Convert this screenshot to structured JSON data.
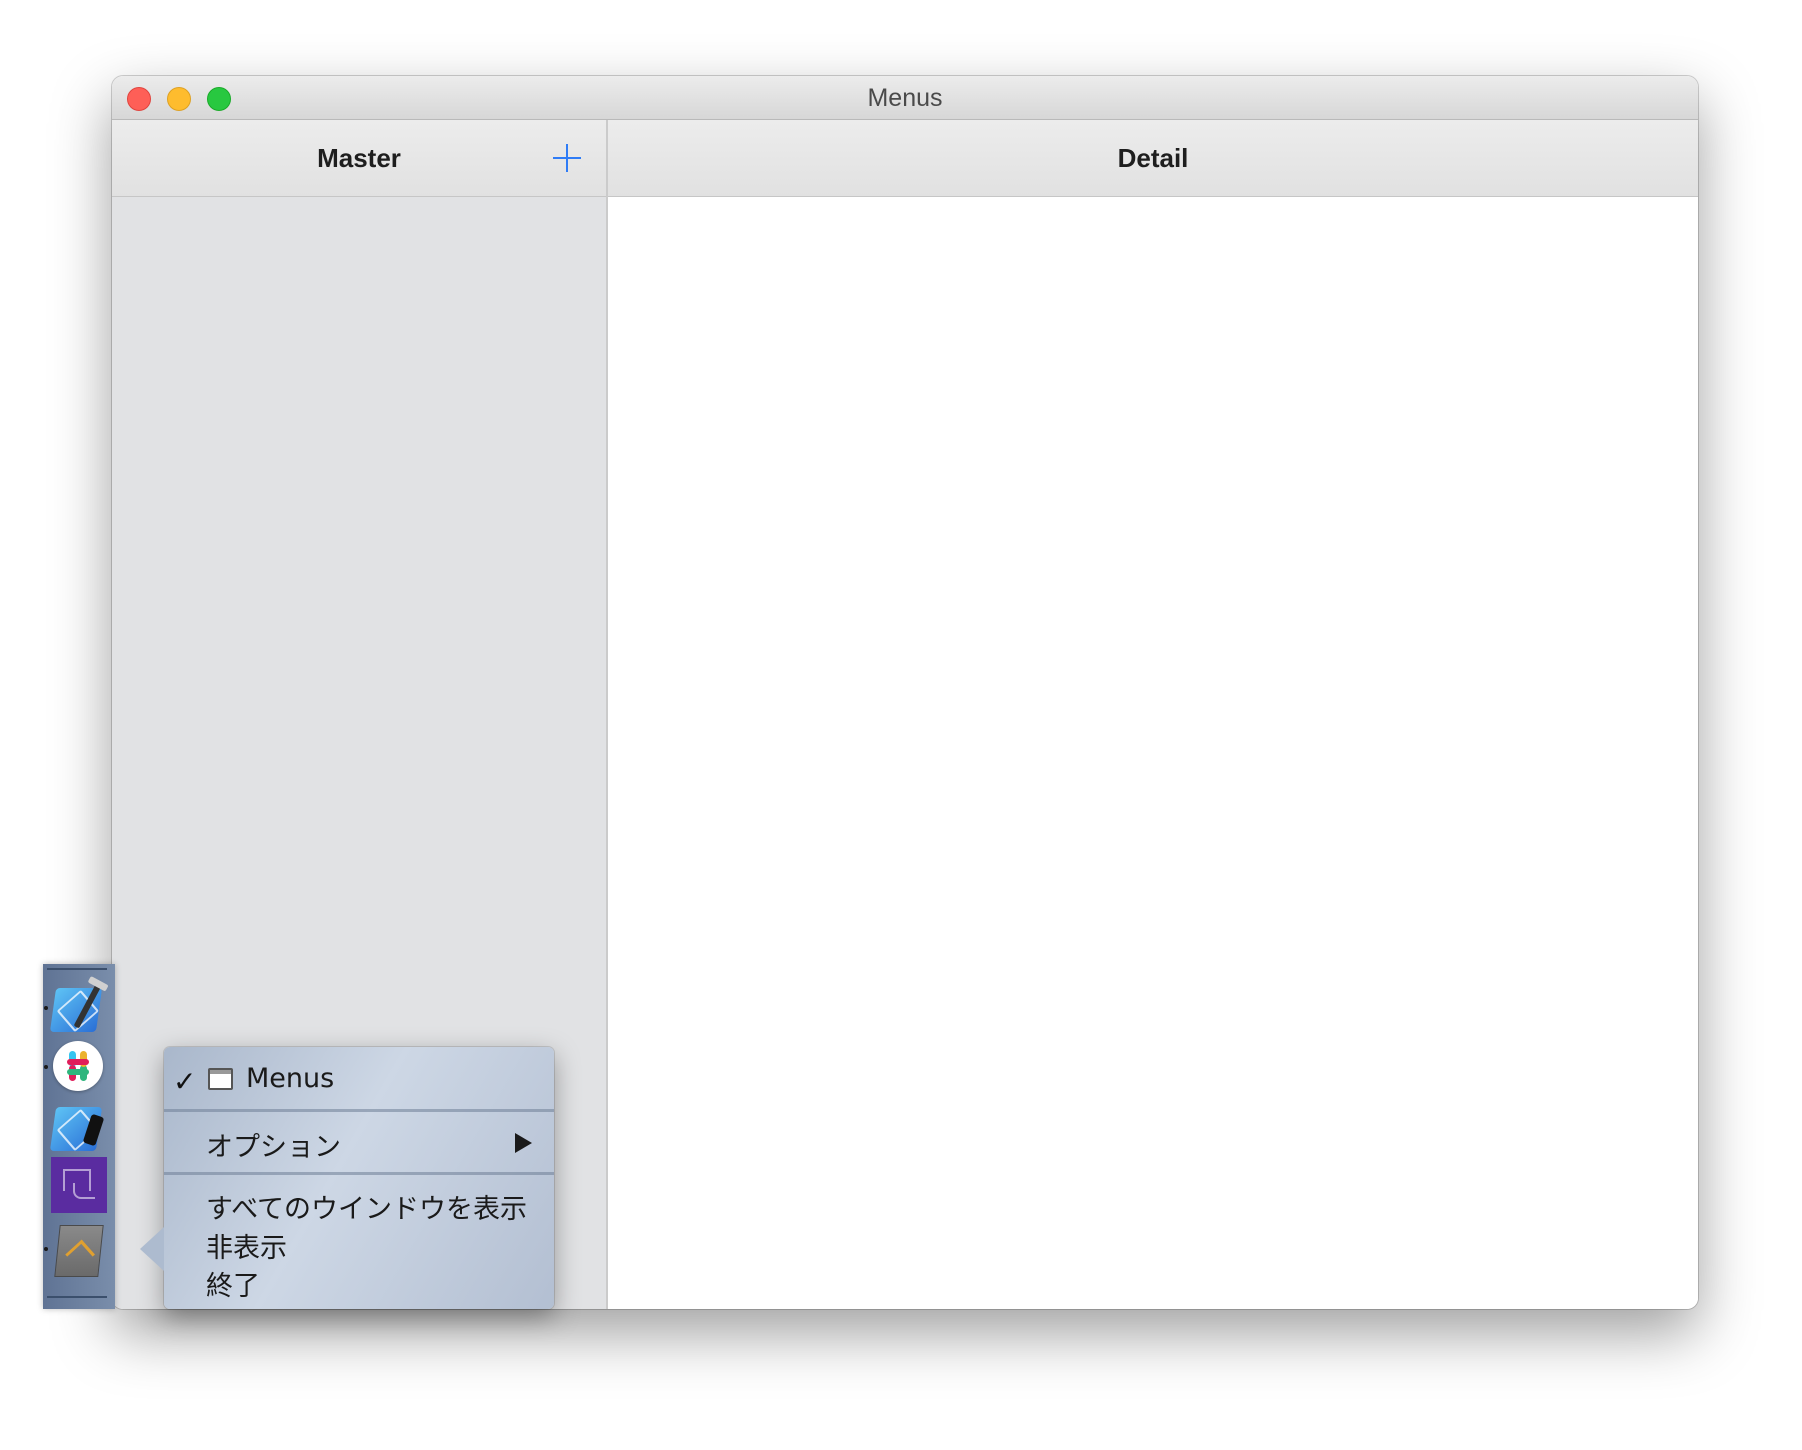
{
  "window": {
    "title": "Menus"
  },
  "master": {
    "title": "Master",
    "add_icon": "plus-icon"
  },
  "detail": {
    "title": "Detail"
  },
  "dock": {
    "items": [
      {
        "icon": "xcode-icon",
        "running": true
      },
      {
        "icon": "slack-icon",
        "running": true
      },
      {
        "icon": "simulator-icon",
        "running": false
      },
      {
        "icon": "purple-app-icon",
        "running": false
      },
      {
        "icon": "menus-app-icon",
        "running": true
      }
    ]
  },
  "context_menu": {
    "window_item": {
      "label": "Menus",
      "checked": true,
      "icon": "window-icon"
    },
    "options_label": "オプション",
    "show_all_windows_label": "すべてのウインドウを表示",
    "hide_label": "非表示",
    "quit_label": "終了"
  },
  "colors": {
    "accent": "#2f7cf6",
    "close": "#fe5f57",
    "minimize": "#febc2e",
    "maximize": "#28c840"
  }
}
